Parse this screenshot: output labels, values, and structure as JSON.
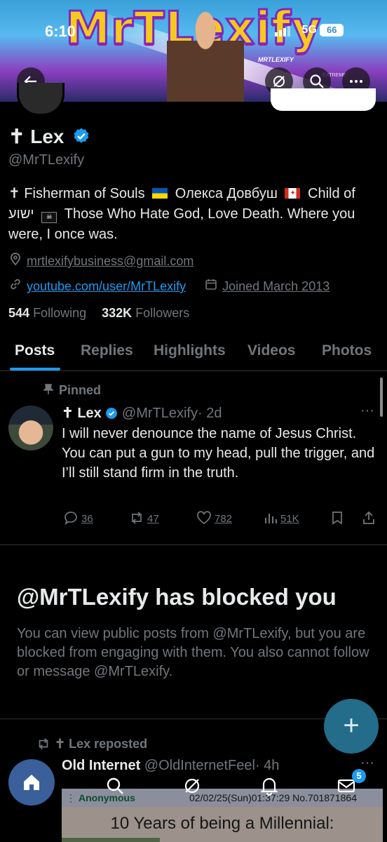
{
  "status": {
    "time": "6:10",
    "network": "5G",
    "battery": "66"
  },
  "banner": {
    "title": "MrTLexify",
    "watermark": "MRTLEXIFY",
    "watermark2": "EXTREME"
  },
  "profile": {
    "name": "✝ Lex",
    "handle": "@MrTLexify",
    "bio": {
      "part1": "✝ Fisherman of Souls",
      "part2": "Олекса Довбуш",
      "part3": "Child of",
      "part4": "ישוע",
      "part5": "Those Who Hate God, Love Death. Where you were, I once was."
    },
    "email": "mrtlexifybusiness@gmail.com",
    "website": "youtube.com/user/MrTLexify",
    "joined": "Joined March 2013",
    "following_count": "544",
    "following_label": "Following",
    "followers_count": "332K",
    "followers_label": "Followers"
  },
  "tabs": [
    "Posts",
    "Replies",
    "Highlights",
    "Videos",
    "Photos"
  ],
  "pinned_tweet": {
    "pinned_label": "Pinned",
    "name": "✝ Lex",
    "handle": "@MrTLexify",
    "time": "· 2d",
    "line1": "I will never denounce the name of Jesus Christ.",
    "line2": "You can put a gun to my head, pull the trigger, and I’ll still stand firm in the truth.",
    "replies": "36",
    "reposts": "47",
    "likes": "782",
    "views": "51K"
  },
  "blocked": {
    "title": "@MrTLexify has blocked you",
    "body": "You can view public posts from @MrTLexify, but you are blocked from engaging with them. You also cannot follow or message @MrTLexify."
  },
  "repost": {
    "label": "✝ Lex reposted",
    "name": "Old Internet",
    "handle": "@OldInternetFeel",
    "time": "· 4h",
    "embed": {
      "anon": "Anonymous",
      "meta": "02/02/25(Sun)01:37:29 No.701871864",
      "headline": "10 Years of being a Millennial:"
    }
  },
  "nav": {
    "mail_badge": "5"
  },
  "colors": {
    "accent": "#1d9bf0",
    "bg": "#000000",
    "muted": "#71767b",
    "fab": "#236c8a"
  }
}
